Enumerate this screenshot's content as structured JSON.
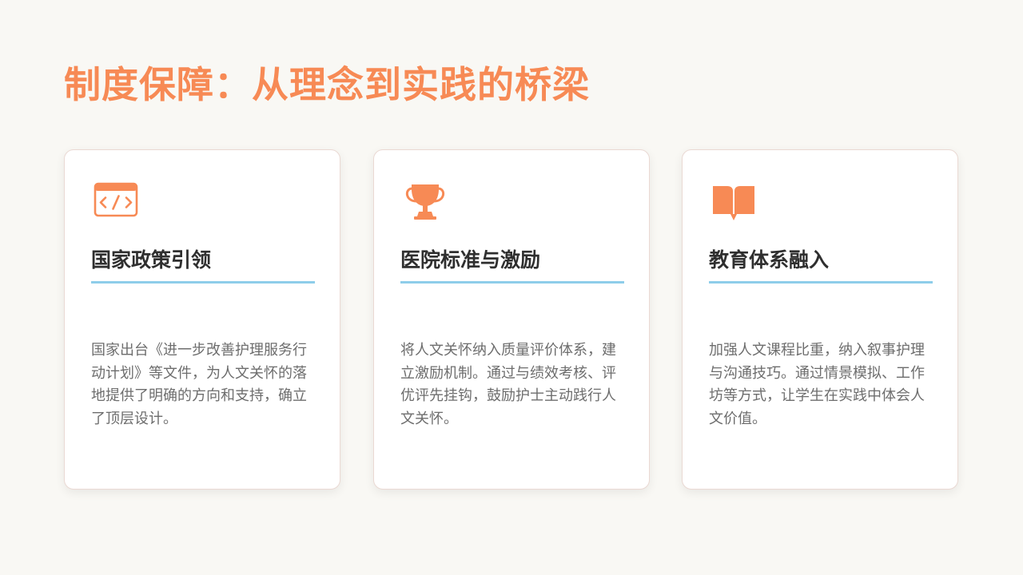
{
  "slide": {
    "title": "制度保障：从理念到实践的桥梁"
  },
  "colors": {
    "accent": "#f78a55",
    "divider": "#8ecdea",
    "heading_text": "#2f2f2f",
    "body_text": "#6d6d6d",
    "background": "#f9f8f4"
  },
  "cards": [
    {
      "icon": "code-window-icon",
      "heading": "国家政策引领",
      "body": "国家出台《进一步改善护理服务行动计划》等文件，为人文关怀的落地提供了明确的方向和支持，确立了顶层设计。"
    },
    {
      "icon": "trophy-icon",
      "heading": "医院标准与激励",
      "body": "将人文关怀纳入质量评价体系，建立激励机制。通过与绩效考核、评优评先挂钩，鼓励护士主动践行人文关怀。"
    },
    {
      "icon": "book-icon",
      "heading": "教育体系融入",
      "body": "加强人文课程比重，纳入叙事护理与沟通技巧。通过情景模拟、工作坊等方式，让学生在实践中体会人文价值。"
    }
  ]
}
